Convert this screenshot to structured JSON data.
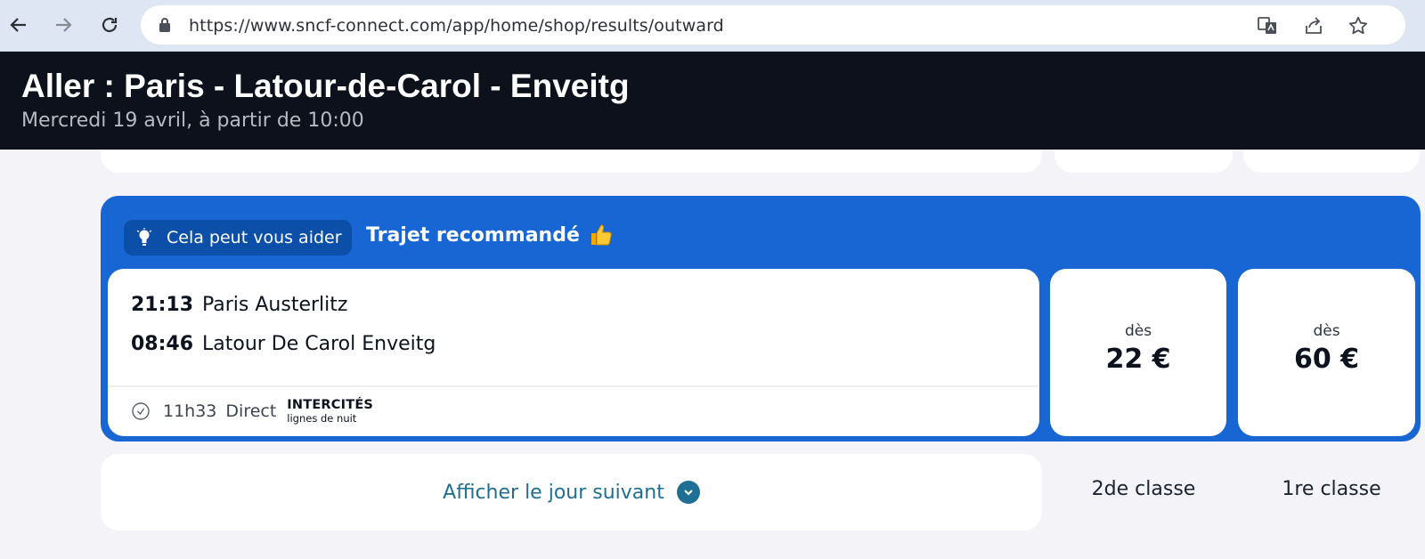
{
  "browser": {
    "url": "https://www.sncf-connect.com/app/home/shop/results/outward"
  },
  "header": {
    "title": "Aller : Paris - Latour-de-Carol - Enveitg",
    "subtitle": "Mercredi 19 avril, à partir de 10:00"
  },
  "recommended": {
    "help_badge": "Cela peut vous aider",
    "title": "Trajet recommandé",
    "journey": {
      "departure_time": "21:13",
      "departure_station": "Paris Austerlitz",
      "arrival_time": "08:46",
      "arrival_station": "Latour De Carol Enveitg",
      "duration": "11h33",
      "connections": "Direct",
      "brand_name": "INTERCITÉS",
      "brand_sub": "lignes de nuit"
    },
    "prices": [
      {
        "from_label": "dès",
        "amount": "22 €"
      },
      {
        "from_label": "dès",
        "amount": "60 €"
      }
    ]
  },
  "footer": {
    "next_day_label": "Afficher le jour suivant",
    "class_2nd": "2de classe",
    "class_1st": "1re classe"
  },
  "colors": {
    "header_bg": "#0c111c",
    "recommended_bg": "#1866d4",
    "badge_bg": "#0c4fa8",
    "link": "#1f6e93",
    "page_bg": "#f3f3f8"
  }
}
